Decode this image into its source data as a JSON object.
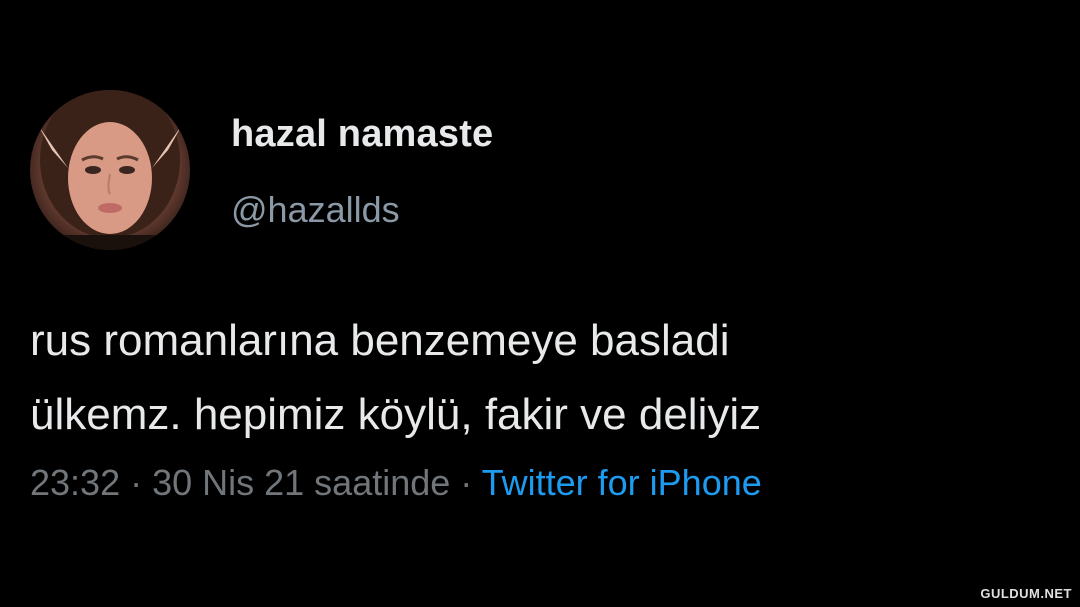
{
  "tweet": {
    "author": {
      "display_name": "hazal namaste",
      "handle": "@hazallds"
    },
    "text_lines": [
      "rus romanlarına benzemeye basladi",
      "ülkemz. hepimiz köylü, fakir ve deliyiz"
    ],
    "meta": {
      "time": "23:32",
      "separator": " · ",
      "date_text": "30 Nis 21 saatinde",
      "source": "Twitter for iPhone"
    }
  },
  "watermark": "GULDUM.NET",
  "colors": {
    "background": "#000000",
    "text": "#e7e9ea",
    "secondary": "#71767b",
    "link": "#1d9bf0"
  }
}
